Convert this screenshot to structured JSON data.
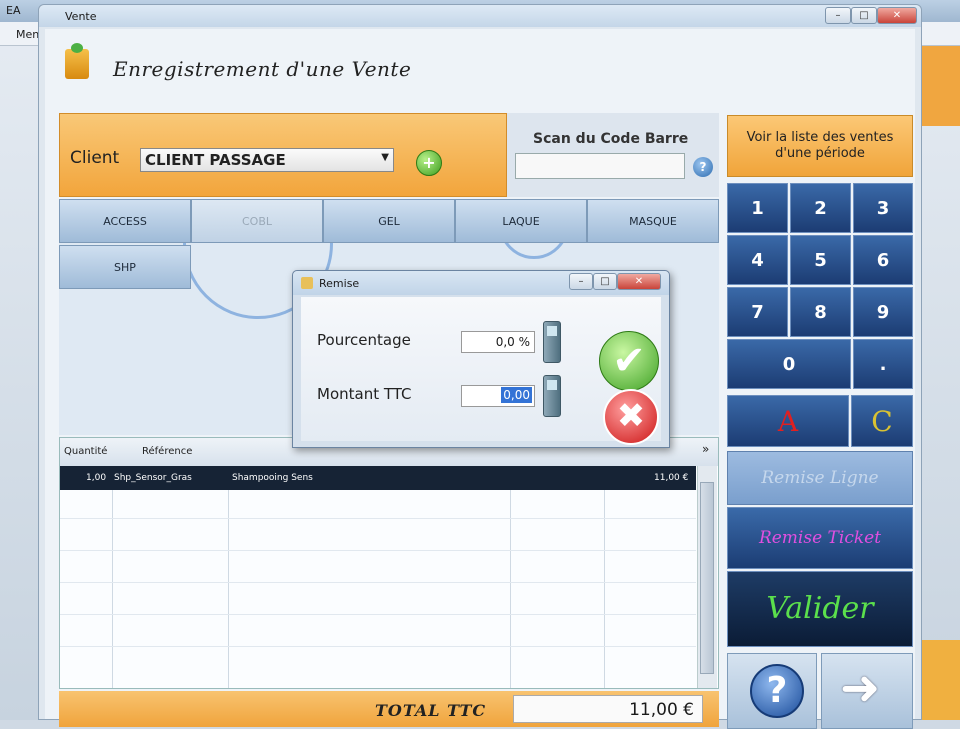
{
  "background_app": {
    "title": "EA",
    "menu": "Menu"
  },
  "window": {
    "title": "Vente",
    "buttons": [
      "–",
      "□",
      "✕"
    ]
  },
  "app_title": "Enregistrement d'une Vente",
  "client": {
    "label": "Client",
    "selected": "CLIENT PASSAGE"
  },
  "scan": {
    "label": "Scan du Code Barre",
    "value": ""
  },
  "categories": [
    "ACCESS",
    "COBL",
    "GEL",
    "LAQUE",
    "MASQUE",
    "SHP"
  ],
  "table": {
    "headers": [
      "Quantité",
      "Référence"
    ],
    "rows": [
      {
        "qty": "1,00",
        "ref": "Shp_Sensor_Gras",
        "designation": "Shampooing Sens",
        "total": "11,00 €"
      }
    ]
  },
  "total": {
    "label": "TOTAL TTC",
    "value": "11,00 €"
  },
  "right_panel": {
    "liste_ventes": "Voir la liste des ventes d'une période",
    "keys": [
      "1",
      "2",
      "3",
      "4",
      "5",
      "6",
      "7",
      "8",
      "9",
      "0",
      "."
    ],
    "key_a": "A",
    "key_c": "C",
    "remise_ligne": "Remise Ligne",
    "remise_ticket": "Remise Ticket",
    "valider": "Valider",
    "help": "?",
    "arrow": "➜"
  },
  "dialog": {
    "title": "Remise",
    "pourcentage_label": "Pourcentage",
    "pourcentage_value": "0,0 %",
    "montant_label": "Montant TTC",
    "montant_value": "0,00"
  },
  "colors": {
    "accent_orange": "#f2a53c",
    "key_blue": "#1c3c73",
    "valider_green": "#5be04c",
    "remise_ticket_magenta": "#e14fe0"
  }
}
